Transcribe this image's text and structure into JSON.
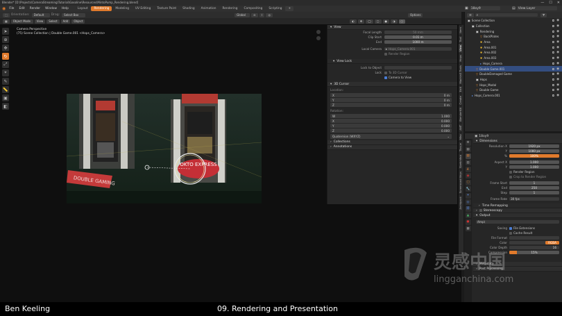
{
  "window": {
    "title": "Blender* [D:\\Projects\\CameraStreaming\\Tutorial\\Gasoline\\Resources\\MintoPump_Rendering.blend]",
    "controls": [
      "—",
      "☐",
      "✕"
    ]
  },
  "menubar": {
    "menus": [
      "File",
      "Edit",
      "Render",
      "Window",
      "Help"
    ],
    "workspaces": [
      "Layout",
      "Rendering",
      "Modeling",
      "UV Editing",
      "Texture Paint",
      "Shading",
      "Animation",
      "Rendering",
      "Compositing",
      "Scripting",
      "+"
    ],
    "active_workspace_index": 1,
    "scene": "18oy9",
    "view_layer": "View Layer"
  },
  "header": {
    "orientation_label": "Orientation:",
    "orientation_value": "Default",
    "drag_label": "Drag:",
    "drag_value": "Select Box",
    "transform_value": "Global",
    "options_label": "Options",
    "mode": "Object Mode",
    "menus": [
      "View",
      "Select",
      "Add",
      "Object"
    ]
  },
  "viewport": {
    "info_line1": "Camera Perspective",
    "info_line2": "(75) Scene Collection | Double Game.001 <Hops_Camera>",
    "render_sign_left": "DOUBLE GAMING",
    "render_sign_right": "OKTO EXPRESS"
  },
  "npanel": {
    "view_section": "View",
    "focal_length_label": "Focal Length",
    "focal_length_value": "50 mm",
    "clip_start_label": "Clip Start",
    "clip_start_value": "0.01 m",
    "clip_end_label": "End",
    "clip_end_value": "1000 m",
    "local_camera_label": "Local Camera",
    "local_camera_value": "Hops_Camera.001",
    "render_region_label": "Render Region",
    "view_lock_section": "View Lock",
    "lock_object_label": "Lock to Object",
    "lock_label": "Lock",
    "lock_3d_cursor": "To 3D Cursor",
    "lock_camera": "Camera to View",
    "cursor_section": "3D Cursor",
    "location_label": "Location:",
    "loc_x_label": "X",
    "loc_x": "0 m",
    "loc_y_label": "Y",
    "loc_y": "0 m",
    "loc_z_label": "Z",
    "loc_z": "0 m",
    "rotation_label": "Rotation:",
    "rot_w_label": "W",
    "rot_w": "1.000",
    "rot_x_label": "X",
    "rot_x": "0.000",
    "rot_y_label": "Y",
    "rot_y": "0.000",
    "rot_z_label": "Z",
    "rot_z": "0.000",
    "rotation_mode": "Quaternion (WXYZ)",
    "collections_section": "Collections",
    "annotations_section": "Annotations",
    "tabs": [
      "Item",
      "Tool",
      "View",
      "Hops",
      "Machin3 Tools",
      "Edit",
      "Create",
      "BlenderKit",
      "ANT",
      "Misc",
      "Tissue",
      "Sketchfab",
      "Screencast Keys",
      "Archipack"
    ]
  },
  "outliner": {
    "rows": [
      {
        "label": "Scene Collection",
        "indent": 0,
        "icon": "collection-icon",
        "selected": false
      },
      {
        "label": "Collection",
        "indent": 1,
        "icon": "collection-icon",
        "selected": false
      },
      {
        "label": "Rendering",
        "indent": 2,
        "icon": "collection-icon",
        "selected": false
      },
      {
        "label": "BackPlates",
        "indent": 3,
        "icon": "object-icon",
        "selected": false
      },
      {
        "label": "Area",
        "indent": 3,
        "icon": "light-icon",
        "selected": false
      },
      {
        "label": "Area.001",
        "indent": 3,
        "icon": "light-icon",
        "selected": false
      },
      {
        "label": "Area.002",
        "indent": 3,
        "icon": "light-icon",
        "selected": false
      },
      {
        "label": "Area.003",
        "indent": 3,
        "icon": "light-icon",
        "selected": false
      },
      {
        "label": "Hops_Camera",
        "indent": 3,
        "icon": "camera-icon",
        "selected": false
      },
      {
        "label": "Double Game.001",
        "indent": 2,
        "icon": "object-icon",
        "selected": true
      },
      {
        "label": "DoubleDamaged Game",
        "indent": 2,
        "icon": "object-icon",
        "selected": false
      },
      {
        "label": "Hops",
        "indent": 2,
        "icon": "collection-icon",
        "selected": false
      },
      {
        "label": "Hops_Modal",
        "indent": 2,
        "icon": "object-icon",
        "selected": false
      },
      {
        "label": "Double Game",
        "indent": 2,
        "icon": "object-icon",
        "selected": false
      },
      {
        "label": "Hops_Camera.001",
        "indent": 1,
        "icon": "camera-icon",
        "selected": false
      }
    ]
  },
  "properties": {
    "scene_name": "18oy9",
    "dimensions_section": "Dimensions",
    "resolution_x_label": "Resolution X",
    "resolution_x": "1920 px",
    "resolution_y_label": "Y",
    "resolution_y": "1080 px",
    "percent_label": "%",
    "percent": "100%",
    "aspect_x_label": "Aspect X",
    "aspect_x": "1.000",
    "aspect_y_label": "Y",
    "aspect_y": "1.000",
    "render_region": "Render Region",
    "crop_region": "Crop to Render Region",
    "frame_start_label": "Frame Start",
    "frame_start": "1",
    "frame_end_label": "End",
    "frame_end": "250",
    "frame_step_label": "Step",
    "frame_step": "1",
    "frame_rate_label": "Frame Rate",
    "frame_rate": "30 fps",
    "time_remapping": "Time Remapping",
    "stereoscopy": "Stereoscopy",
    "output_section": "Output",
    "output_path": "/tmp\\",
    "saving_label": "Saving",
    "file_extensions": "File Extensions",
    "cache_result": "Cache Result",
    "file_format_label": "File Format",
    "color_label": "Color",
    "color_value": "RGBA",
    "color_depth_label": "Color Depth",
    "color_depth_value": "16",
    "compression_label": "Compression",
    "compression_value": "15%",
    "metadata_section": "Metadata",
    "postprocessing_section": "Post Processing"
  },
  "caption": {
    "author": "Ben Keeling",
    "chapter": "09. Rendering and Presentation"
  },
  "watermark": {
    "cn": "灵感中国",
    "url": "lingganchina.com"
  },
  "colors": {
    "accent": "#e07a2c",
    "selection": "#334d80",
    "checkbox_on": "#4a7dd6"
  }
}
